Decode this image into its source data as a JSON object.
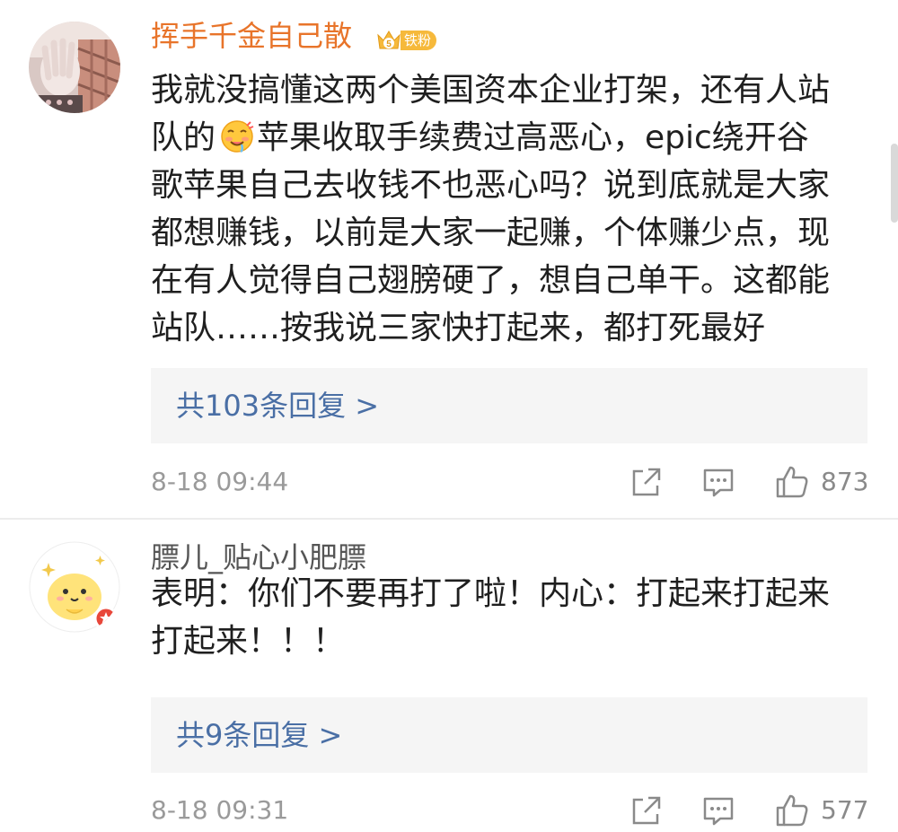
{
  "comments": [
    {
      "username": "挥手千金自己散",
      "badge": {
        "level": "5",
        "label": "铁粉"
      },
      "lines": [
        "我就没搞懂这两个美国资本企业打架，还有人站",
        {
          "before": "队的",
          "emoji": "drooling-face-emoji",
          "after": "苹果收取手续费过高恶心，epic绕开谷"
        },
        "歌苹果自己去收钱不也恶心吗？说到底就是大家",
        "都想赚钱，以前是大家一起赚，个体赚少点，现",
        "在有人觉得自己翅膀硬了，想自己单干。这都能",
        "站队……按我说三家快打起来，都打死最好"
      ],
      "replies": "共103条回复 >",
      "timestamp": "8-18 09:44",
      "likes": "873"
    },
    {
      "username": "膘儿_贴心小肥膘",
      "lines": [
        "表明：你们不要再打了啦！内心：打起来打起来",
        "打起来！！！"
      ],
      "replies": "共9条回复 >",
      "timestamp": "8-18 09:31",
      "likes": "577"
    }
  ],
  "icons": {
    "share": "share-icon",
    "comment": "comment-icon",
    "like": "thumbs-up-icon"
  },
  "colors": {
    "username_highlight": "#e8742a",
    "link": "#4a6fa5",
    "meta": "#9a9a9a",
    "badge": "#f6b93b"
  }
}
